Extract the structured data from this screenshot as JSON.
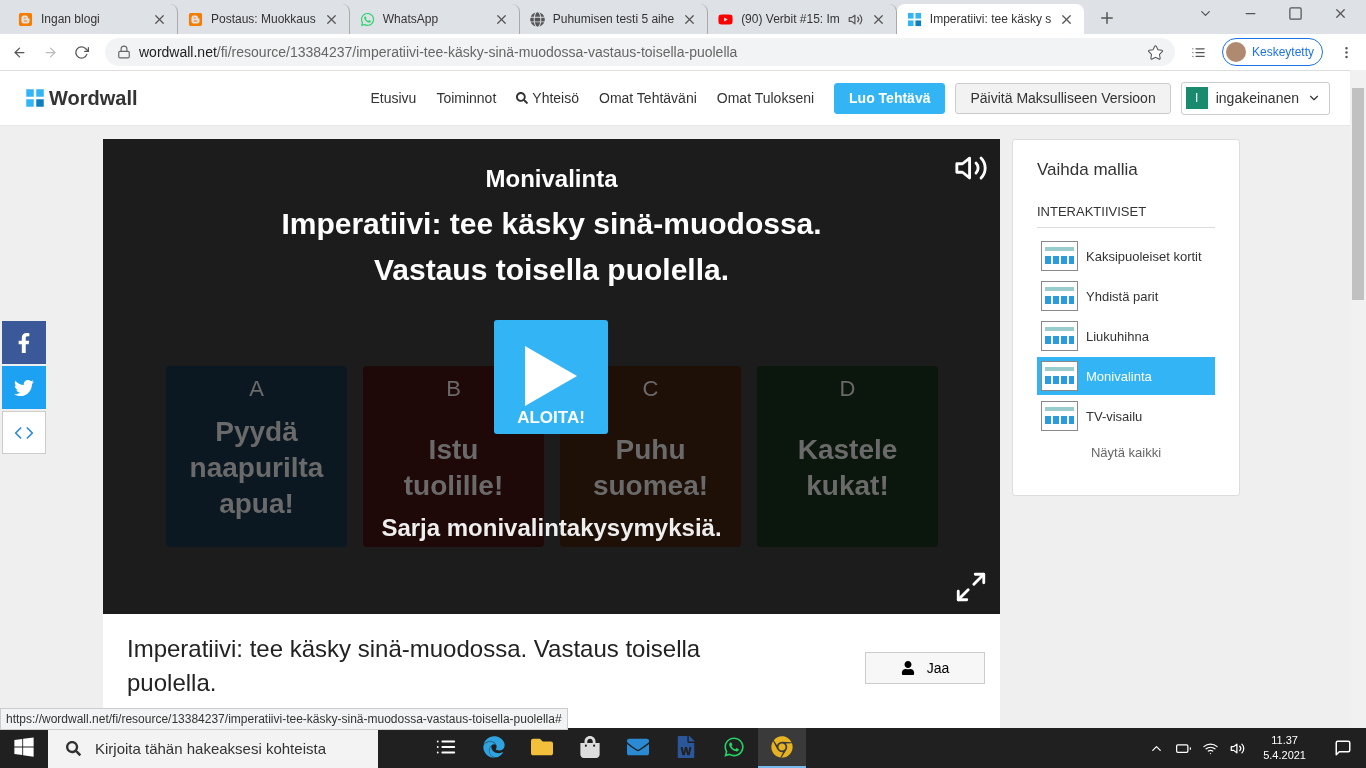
{
  "browser": {
    "tabs": [
      {
        "title": "Ingan blogi",
        "kind": "blog",
        "selected": false,
        "audio": false
      },
      {
        "title": "Postaus: Muokkaus",
        "kind": "blog",
        "selected": false,
        "audio": false
      },
      {
        "title": "WhatsApp",
        "kind": "chat",
        "selected": false,
        "audio": false
      },
      {
        "title": "Puhumisen testi 5 aihe",
        "kind": "globe",
        "selected": false,
        "audio": false
      },
      {
        "title": "(90) Verbit #15: Im",
        "kind": "video",
        "selected": false,
        "audio": true
      },
      {
        "title": "Imperatiivi: tee käsky s",
        "kind": "site",
        "selected": true,
        "audio": false
      }
    ],
    "address_host": "wordwall.net",
    "address_path": "/fi/resource/13384237/imperatiivi-tee-käsky-sinä-muodossa-vastaus-toisella-puolella",
    "profile": "Keskeytetty"
  },
  "site": {
    "logo": "Wordwall",
    "nav": [
      {
        "label": "Etusivu",
        "kind": "link"
      },
      {
        "label": "Toiminnot",
        "kind": "link"
      },
      {
        "label": "Yhteisö",
        "kind": "search"
      },
      {
        "label": "Omat Tehtäväni",
        "kind": "link"
      },
      {
        "label": "Omat Tulokseni",
        "kind": "link"
      },
      {
        "label": "Luo Tehtävä",
        "kind": "primary"
      },
      {
        "label": "Päivitä Maksulliseen Versioon",
        "kind": "outline"
      }
    ],
    "user": {
      "initial": "I",
      "name": "ingakeinanen"
    }
  },
  "game": {
    "type": "Monivalinta",
    "title_lines": [
      "Imperatiivi: tee käsky sinä-muodossa.",
      "Vastaus toisella puolella."
    ],
    "answers": [
      {
        "letter": "A",
        "text": "Pyydä naapurilta apua!",
        "color": "#0b1821"
      },
      {
        "letter": "B",
        "text": "Istu tuolille!",
        "color": "#1f0808"
      },
      {
        "letter": "C",
        "text": "Puhu suomea!",
        "color": "#1f1007"
      },
      {
        "letter": "D",
        "text": "Kastele kukat!",
        "color": "#0b170c"
      }
    ],
    "play_label": "ALOITA!",
    "subtitle": "Sarja monivalintakysymyksiä."
  },
  "resource": {
    "title": "Imperatiivi: tee käsky sinä-muodossa. Vastaus toisella puolella.",
    "share": "Jaa"
  },
  "sidebar": {
    "heading": "Vaihda mallia",
    "section": "INTERAKTIIVISET",
    "templates": [
      {
        "label": "Kaksipuoleiset kortit",
        "selected": false
      },
      {
        "label": "Yhdistä parit",
        "selected": false
      },
      {
        "label": "Liukuhihna",
        "selected": false
      },
      {
        "label": "Monivalinta",
        "selected": true
      },
      {
        "label": "TV-visailu",
        "selected": false
      }
    ],
    "show_all": "Näytä kaikki"
  },
  "social": [
    {
      "kind": "facebook"
    },
    {
      "kind": "twitter"
    },
    {
      "kind": "embed"
    }
  ],
  "status_url": "https://wordwall.net/fi/resource/13384237/imperatiivi-tee-käsky-sinä-muodossa-vastaus-toisella-puolella#",
  "taskbar": {
    "search_placeholder": "Kirjoita tähän hakeaksesi kohteista",
    "apps": [
      {
        "kind": "tasks",
        "active": false
      },
      {
        "kind": "edge",
        "active": false
      },
      {
        "kind": "folder",
        "active": false
      },
      {
        "kind": "store",
        "active": false
      },
      {
        "kind": "mail",
        "active": false
      },
      {
        "kind": "word",
        "active": false
      },
      {
        "kind": "chat",
        "active": false
      },
      {
        "kind": "chrome",
        "active": true
      }
    ],
    "time": "11.37",
    "date": "5.4.2021"
  }
}
